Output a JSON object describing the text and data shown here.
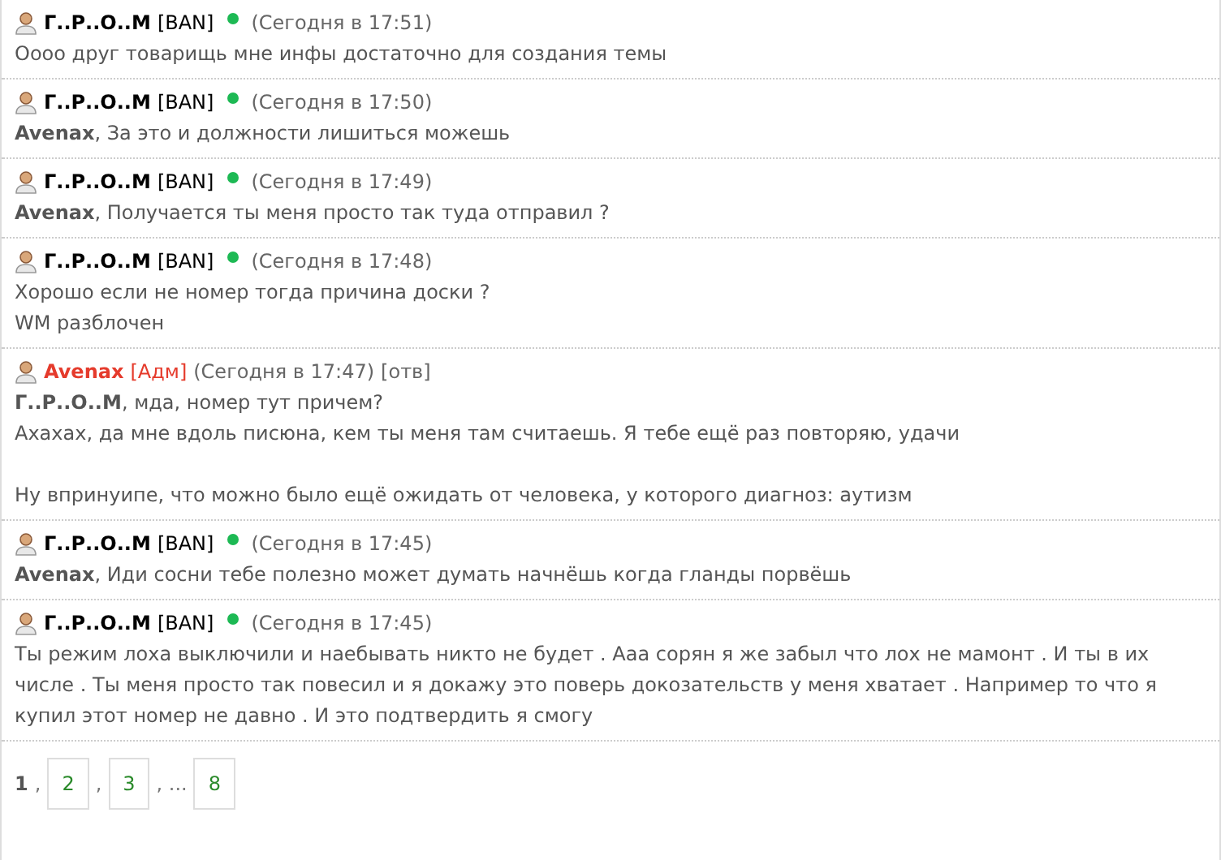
{
  "posts": [
    {
      "author": "Г..Р..О..М",
      "kind": "user",
      "role": "[BAN]",
      "online": true,
      "time": "(Сегодня в 17:51)",
      "paragraphs": [
        [
          "Оооо друг товарищь мне инфы достаточно для создания темы"
        ]
      ]
    },
    {
      "author": "Г..Р..О..М",
      "kind": "user",
      "role": "[BAN]",
      "online": true,
      "time": "(Сегодня в 17:50)",
      "paragraphs": [
        [
          "**Avenax**, За это и должности лишиться можешь"
        ]
      ]
    },
    {
      "author": "Г..Р..О..М",
      "kind": "user",
      "role": "[BAN]",
      "online": true,
      "time": "(Сегодня в 17:49)",
      "paragraphs": [
        [
          "**Avenax**, Получается ты меня просто так туда отправил ?"
        ]
      ]
    },
    {
      "author": "Г..Р..О..М",
      "kind": "user",
      "role": "[BAN]",
      "online": true,
      "time": "(Сегодня в 17:48)",
      "paragraphs": [
        [
          "Хорошо если не номер тогда причина доски ?",
          "WM разблочен"
        ]
      ]
    },
    {
      "author": "Avenax",
      "kind": "admin",
      "role": "[Адм]",
      "online": false,
      "time": "(Сегодня в 17:47)",
      "reply": "[отв]",
      "paragraphs": [
        [
          "**Г..Р..О..М**, мда, номер тут причем?",
          "Ахахах, да мне вдоль писюна, кем ты меня там считаешь. Я тебе ещё раз повторяю, удачи"
        ],
        [
          "Ну впринуипе, что можно было ещё ожидать от человека, у которого диагноз: аутизм"
        ]
      ]
    },
    {
      "author": "Г..Р..О..М",
      "kind": "user",
      "role": "[BAN]",
      "online": true,
      "time": "(Сегодня в 17:45)",
      "paragraphs": [
        [
          "**Avenax**, Иди сосни тебе полезно может думать начнёшь когда гланды порвёшь"
        ]
      ]
    },
    {
      "author": "Г..Р..О..М",
      "kind": "user",
      "role": "[BAN]",
      "online": true,
      "time": "(Сегодня в 17:45)",
      "paragraphs": [
        [
          "Ты режим лоха выключили и наебывать никто не будет . Ааа сорян я же забыл что лох не мамонт . И ты в их числе . Ты меня просто так повесил и я докажу это поверь докозательств у меня хватает . Например то что я купил этот номер не давно . И это подтвердить я смогу"
        ]
      ]
    }
  ],
  "pagination": [
    {
      "kind": "page",
      "label": "1",
      "selected": true
    },
    {
      "kind": "sep",
      "label": ","
    },
    {
      "kind": "page",
      "label": "2",
      "selected": false
    },
    {
      "kind": "sep",
      "label": ","
    },
    {
      "kind": "page",
      "label": "3",
      "selected": false
    },
    {
      "kind": "sep",
      "label": ", ..."
    },
    {
      "kind": "page",
      "label": "8",
      "selected": false
    }
  ]
}
